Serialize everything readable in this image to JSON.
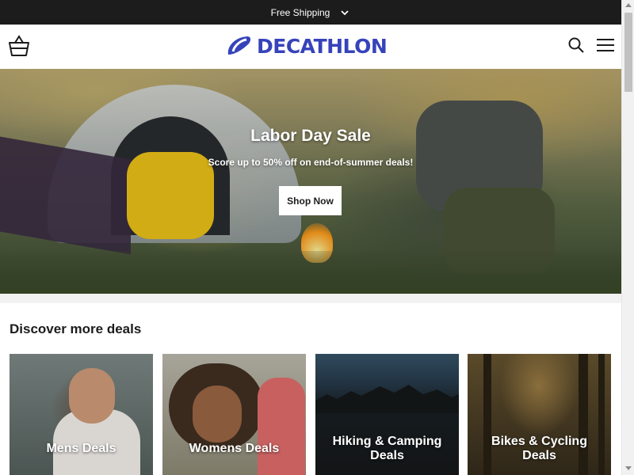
{
  "announcement": {
    "text": "Free Shipping",
    "toggle_icon": "chevron-down-icon"
  },
  "header": {
    "brand": "DECATHLON",
    "brand_color": "#3643ba",
    "icons": {
      "cart": "basket-icon",
      "search": "search-icon",
      "menu": "hamburger-menu-icon"
    }
  },
  "hero": {
    "title": "Labor Day Sale",
    "subtitle": "Score up to 50% off on end-of-summer deals!",
    "cta": "Shop Now"
  },
  "deals": {
    "heading": "Discover more deals",
    "cards": [
      {
        "label": "Mens Deals"
      },
      {
        "label": "Womens Deals"
      },
      {
        "label": "Hiking & Camping Deals"
      },
      {
        "label": "Bikes & Cycling Deals"
      }
    ]
  },
  "colors": {
    "topbar_bg": "#1c1c1c",
    "brand": "#3643ba",
    "text": "#1c1c1c"
  }
}
